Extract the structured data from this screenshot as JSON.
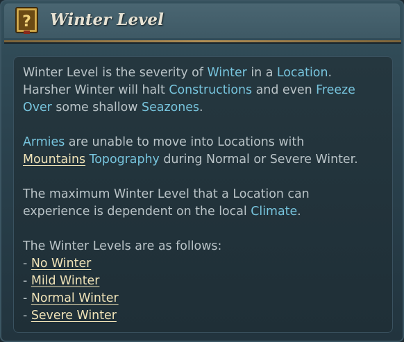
{
  "title": "Winter Level",
  "icon": "help-book-icon",
  "colors": {
    "keyword": "#77c4dd",
    "link": "#f0e3b8",
    "body_text": "#b9c3c7",
    "title_text": "#e8e3d4",
    "gold_trim": "#b28f55"
  },
  "para1": {
    "t1": "Winter Level is the severity of ",
    "k1": "Winter",
    "t2": " in a ",
    "k2": "Location",
    "t3": ".",
    "t4": "Harsher Winter will halt ",
    "k3": "Constructions",
    "t5": " and even ",
    "k4": "Freeze",
    "k5": "Over",
    "t6": " some shallow ",
    "k6": "Seazones",
    "t7": "."
  },
  "para2": {
    "k1": "Armies",
    "t1": " are unable to move into Locations with",
    "l1": "Mountains",
    "t2": " ",
    "k2": "Topography",
    "t3": " during Normal or Severe Winter."
  },
  "para3": {
    "t1": "The maximum Winter Level that a Location can",
    "t2": "experience is dependent on the local ",
    "k1": "Climate",
    "t3": "."
  },
  "list": {
    "intro": "The Winter Levels are as follows:",
    "dash": " - ",
    "items": [
      "No Winter",
      "Mild Winter",
      "Normal Winter",
      "Severe Winter"
    ]
  }
}
